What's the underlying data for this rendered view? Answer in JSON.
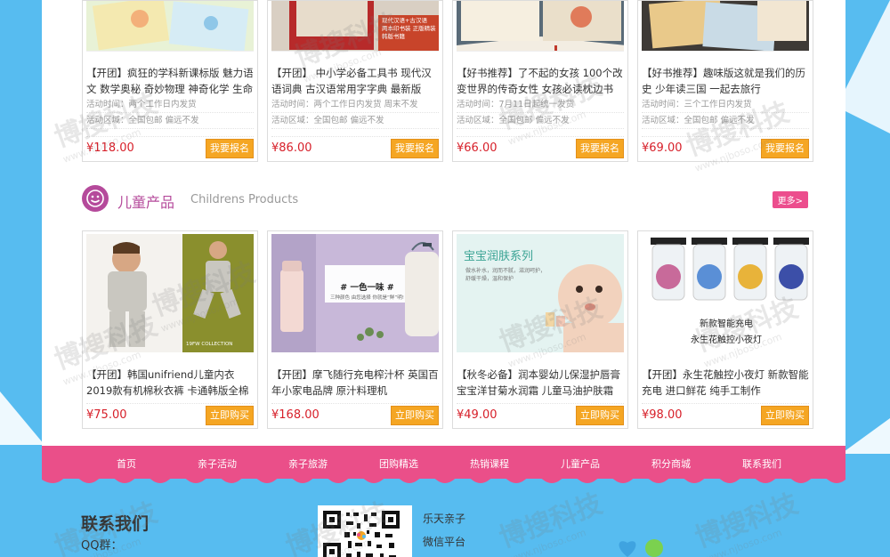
{
  "top_products": [
    {
      "title": "【开团】疯狂的学科新课标版 魅力语文 数学奥秘 奇妙物理 神奇化学 生命科",
      "time": "活动时间：两个工作日内发货",
      "area": "活动区域：全国包邮 偏远不发",
      "price": "¥118.00",
      "button": "我要报名"
    },
    {
      "title": "【开团】 中小学必备工具书 现代汉语词典 古汉语常用字字典 最新版",
      "time": "活动时间：两个工作日内发货 周末不发",
      "area": "活动区域：全国包邮 偏远不发",
      "price": "¥86.00",
      "button": "我要报名",
      "image_text": [
        "现代汉语+古汉语",
        "两本印书装 正版精装",
        "韩版书籍"
      ]
    },
    {
      "title": "【好书推荐】了不起的女孩 100个改变世界的传奇女性 女孩必读枕边书",
      "time": "活动时间：7月11日起统一发货",
      "area": "活动区域：全国包邮 偏远不发",
      "price": "¥66.00",
      "button": "我要报名"
    },
    {
      "title": "【好书推荐】趣味版这就是我们的历史 少年读三国 一起去旅行",
      "time": "活动时间：三个工作日内发货",
      "area": "活动区域：全国包邮 偏远不发",
      "price": "¥69.00",
      "button": "我要报名"
    }
  ],
  "section": {
    "title": "儿童产品",
    "subtitle": "Childrens Products",
    "more": "更多>"
  },
  "kids_products": [
    {
      "title": "【开团】韩国unifriend儿童内衣 2019款有机棉秋衣裤 卡通韩版全棉套装",
      "price": "¥75.00",
      "button": "立即购买",
      "image_text": "19FW COLLECTION"
    },
    {
      "title": "【开团】摩飞随行充电榨汁杯 英国百年小家电品牌 原汁料理机",
      "price": "¥168.00",
      "button": "立即购买",
      "image_text": [
        "# 一色一味 #",
        "三种颜色 由您选择 你就是“鲜”明!"
      ]
    },
    {
      "title": "【秋冬必备】润本婴幼儿保湿护唇膏 宝宝洋甘菊水润霜 儿童马油护肤霜",
      "price": "¥49.00",
      "button": "立即购买",
      "image_text": [
        "宝宝润肤系列",
        "做水补水，润而不腻，滋润呵护，",
        "舒缓干燥，温和保护"
      ]
    },
    {
      "title": "【开团】永生花触控小夜灯 新款智能充电 进口鲜花 纯手工制作",
      "price": "¥98.00",
      "button": "立即购买",
      "image_text": [
        "新款智能充电",
        "永生花触控小夜灯"
      ]
    }
  ],
  "nav": [
    "首页",
    "亲子活动",
    "亲子旅游",
    "团购精选",
    "热销课程",
    "儿童产品",
    "积分商城",
    "联系我们"
  ],
  "footer": {
    "contact_title": "联系我们",
    "qq": "QQ群：",
    "brand": "乐天亲子",
    "brand_sub": "微信平台"
  },
  "watermark": {
    "text": "博搜科技",
    "url": "www.njboso.com"
  },
  "colors": {
    "accent_pink": "#ea4f89",
    "section_purple": "#b54a9b",
    "price_red": "#d7202a",
    "button_orange": "#f5a623",
    "bg_blue": "#57bcf0"
  }
}
